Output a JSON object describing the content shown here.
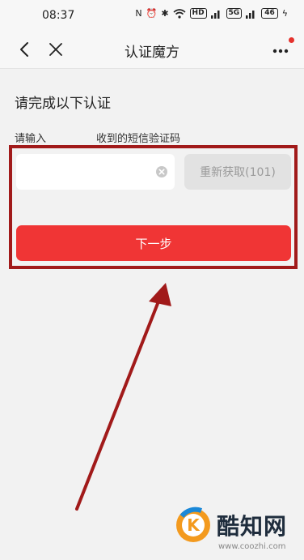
{
  "status_bar": {
    "time": "08:37",
    "signal1_badge": "HD",
    "signal2_badge": "5G",
    "battery": "46"
  },
  "nav": {
    "title": "认证魔方",
    "accent_dot_color": "#e5322d"
  },
  "form": {
    "heading": "请完成以下认证",
    "label": "请输入",
    "hint": "收到的短信验证码",
    "code_value": "",
    "resend_label": "重新获取(101)",
    "next_label": "下一步"
  },
  "colors": {
    "primary_button": "#f03535",
    "annotation": "#a11a1a"
  },
  "watermark": {
    "brand": "酷知网",
    "url": "www.coozhi.com"
  }
}
